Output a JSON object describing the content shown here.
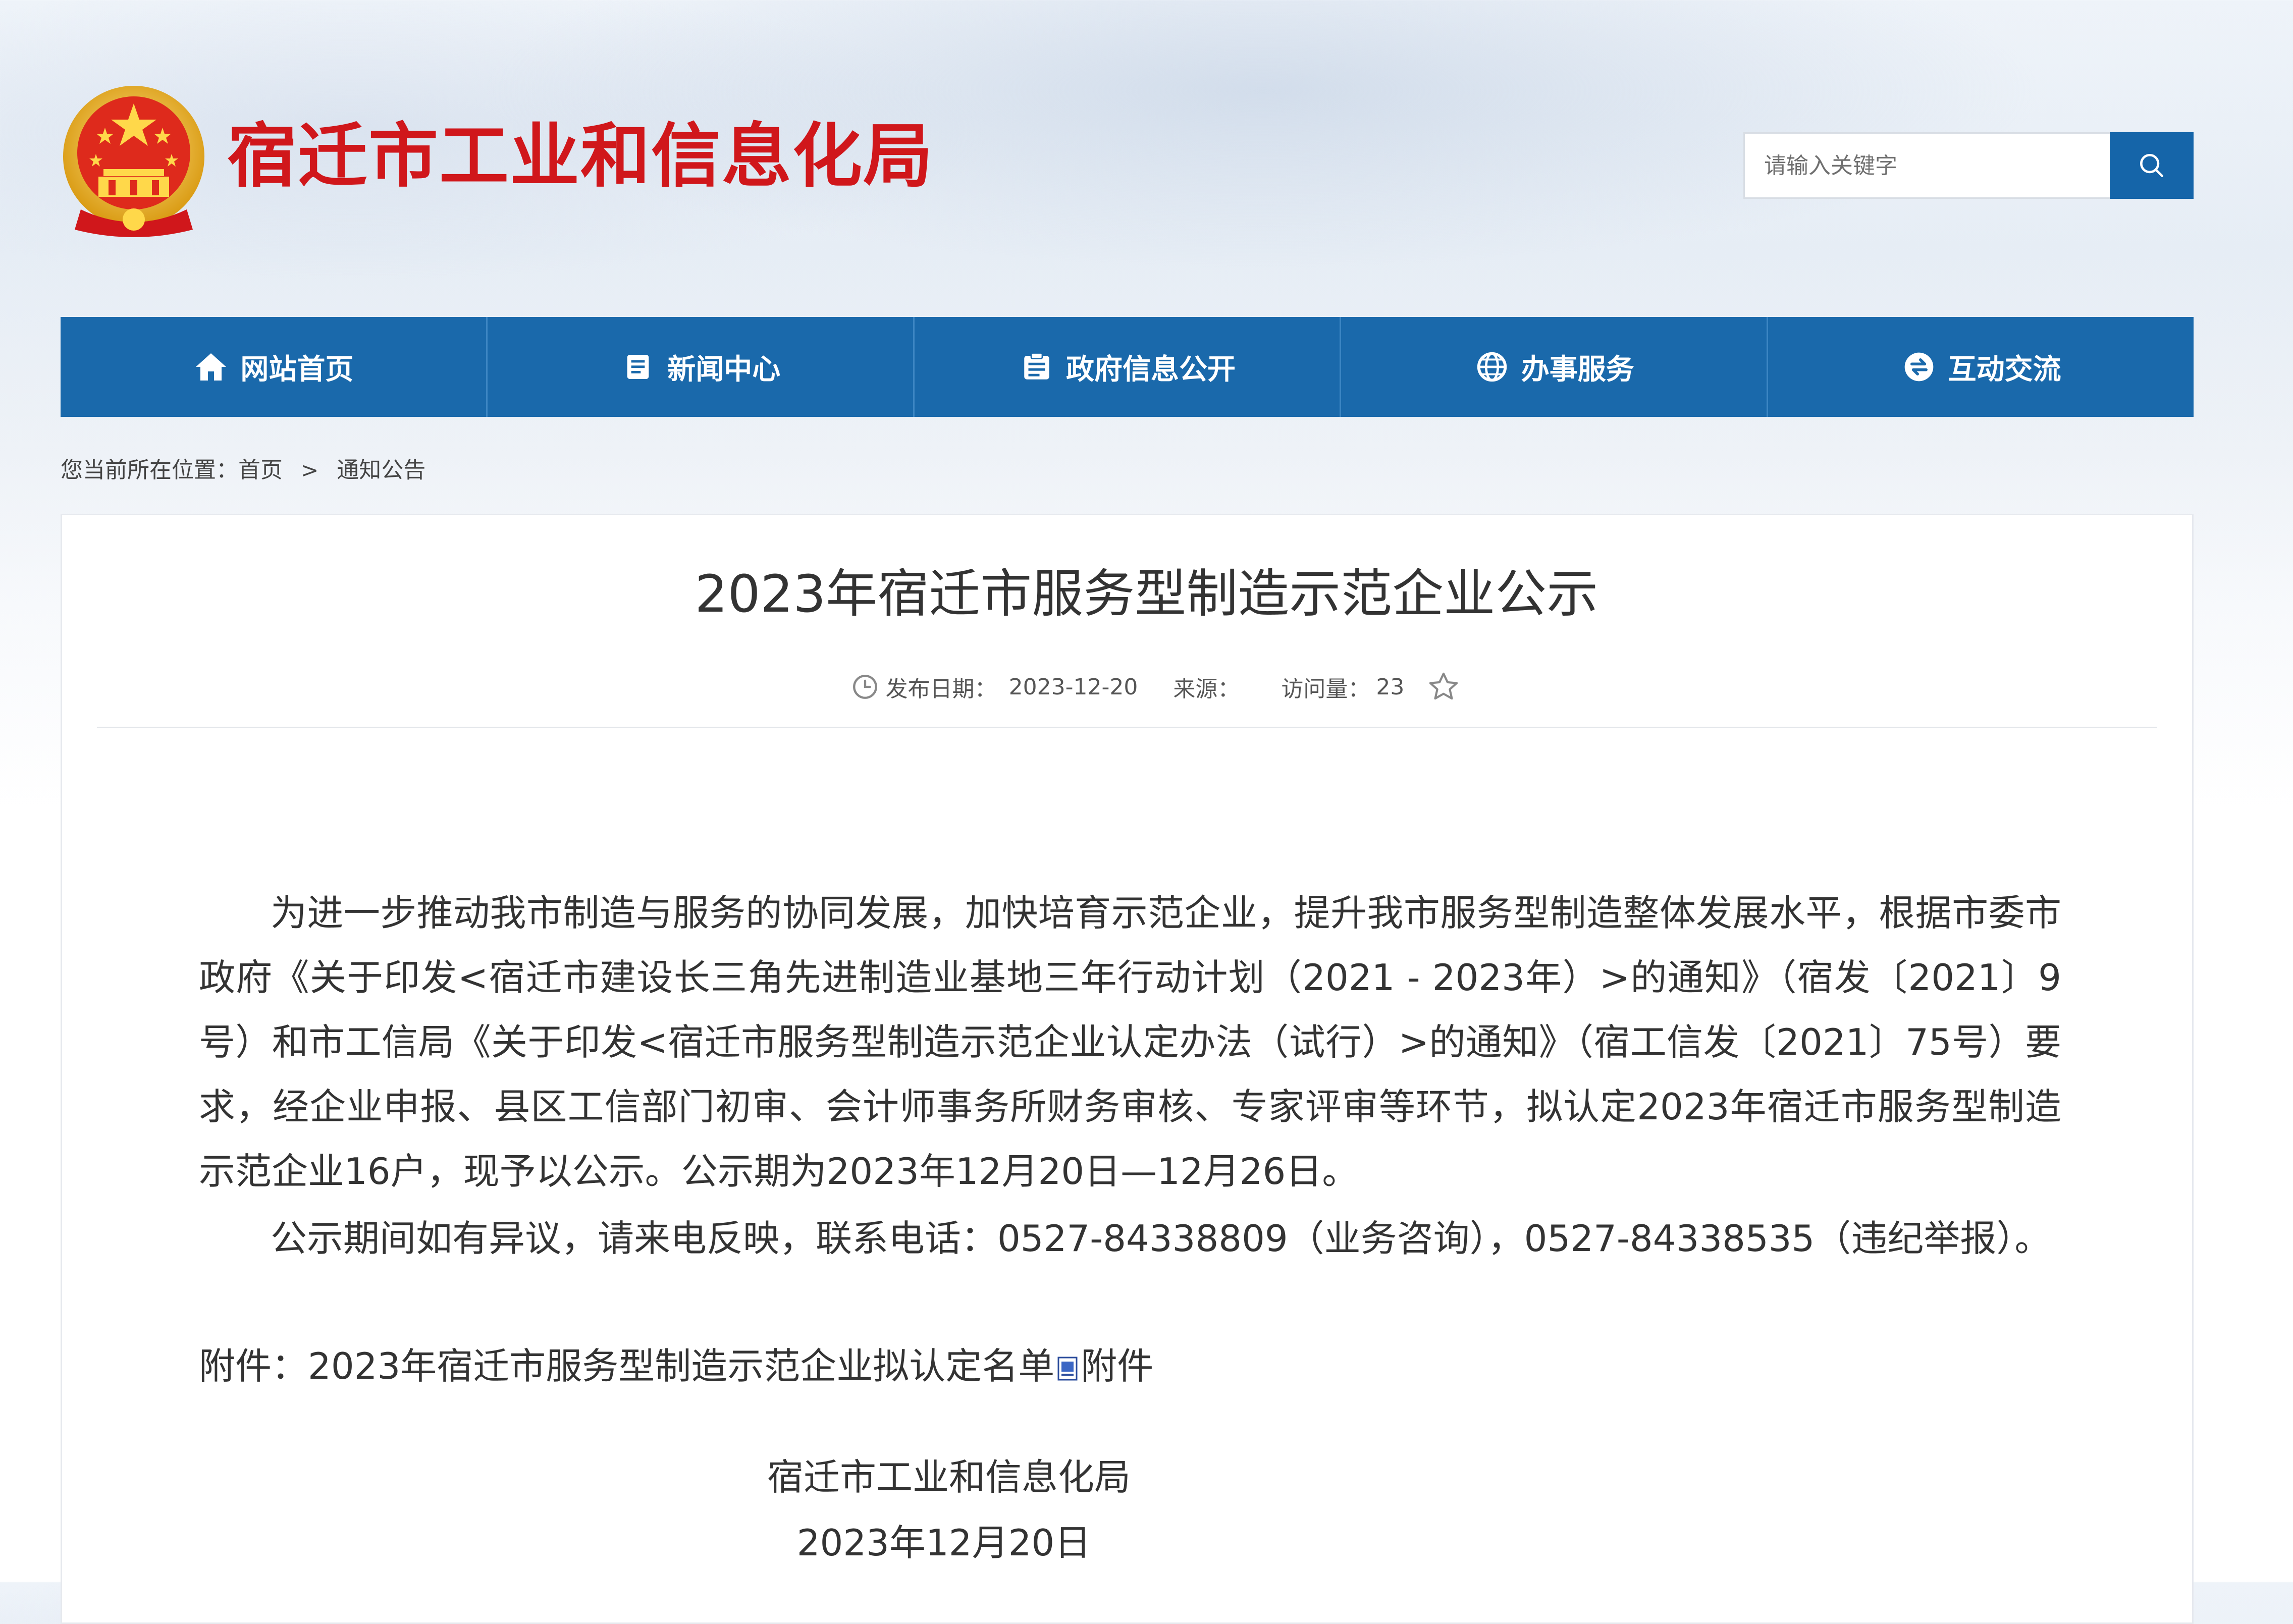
{
  "header": {
    "site_title": "宿迁市工业和信息化局",
    "search": {
      "placeholder": "请输入关键字"
    }
  },
  "nav": {
    "items": [
      {
        "label": "网站首页",
        "icon": "home-icon"
      },
      {
        "label": "新闻中心",
        "icon": "news-icon"
      },
      {
        "label": "政府信息公开",
        "icon": "gov-info-icon"
      },
      {
        "label": "办事服务",
        "icon": "globe-icon"
      },
      {
        "label": "互动交流",
        "icon": "exchange-icon"
      }
    ]
  },
  "breadcrumb": {
    "prefix": "您当前所在位置：",
    "home": "首页",
    "separator": ">",
    "current": "通知公告"
  },
  "article": {
    "title": "2023年宿迁市服务型制造示范企业公示",
    "date_label": "发布日期：",
    "date": "2023-12-20",
    "source_label": "来源：",
    "source": "",
    "views_label": "访问量：",
    "views": "23",
    "body_p1": "为进一步推动我市制造与服务的协同发展，加快培育示范企业，提升我市服务型制造整体发展水平，根据市委市政府《关于印发<宿迁市建设长三角先进制造业基地三年行动计划（2021 - 2023年）>的通知》（宿发〔2021〕9号）和市工信局《关于印发<宿迁市服务型制造示范企业认定办法（试行）>的通知》（宿工信发〔2021〕75号）要求，经企业申报、县区工信部门初审、会计师事务所财务审核、专家评审等环节，拟认定2023年宿迁市服务型制造示范企业16户，现予以公示。公示期为2023年12月20日—12月26日。",
    "body_p2": "公示期间如有异议，请来电反映，联系电话：0527-84338809（业务咨询），0527-84338535（违纪举报）。",
    "attachment_prefix": "附件：",
    "attachment_name": "2023年宿迁市服务型制造示范企业拟认定名单",
    "attachment_suffix": "附件",
    "signature_org": "宿迁市工业和信息化局",
    "signature_date": "2023年12月20日"
  },
  "colors": {
    "brand_red": "#d0171b",
    "nav_blue": "#1a69ab",
    "search_button_blue": "#1565a9"
  }
}
